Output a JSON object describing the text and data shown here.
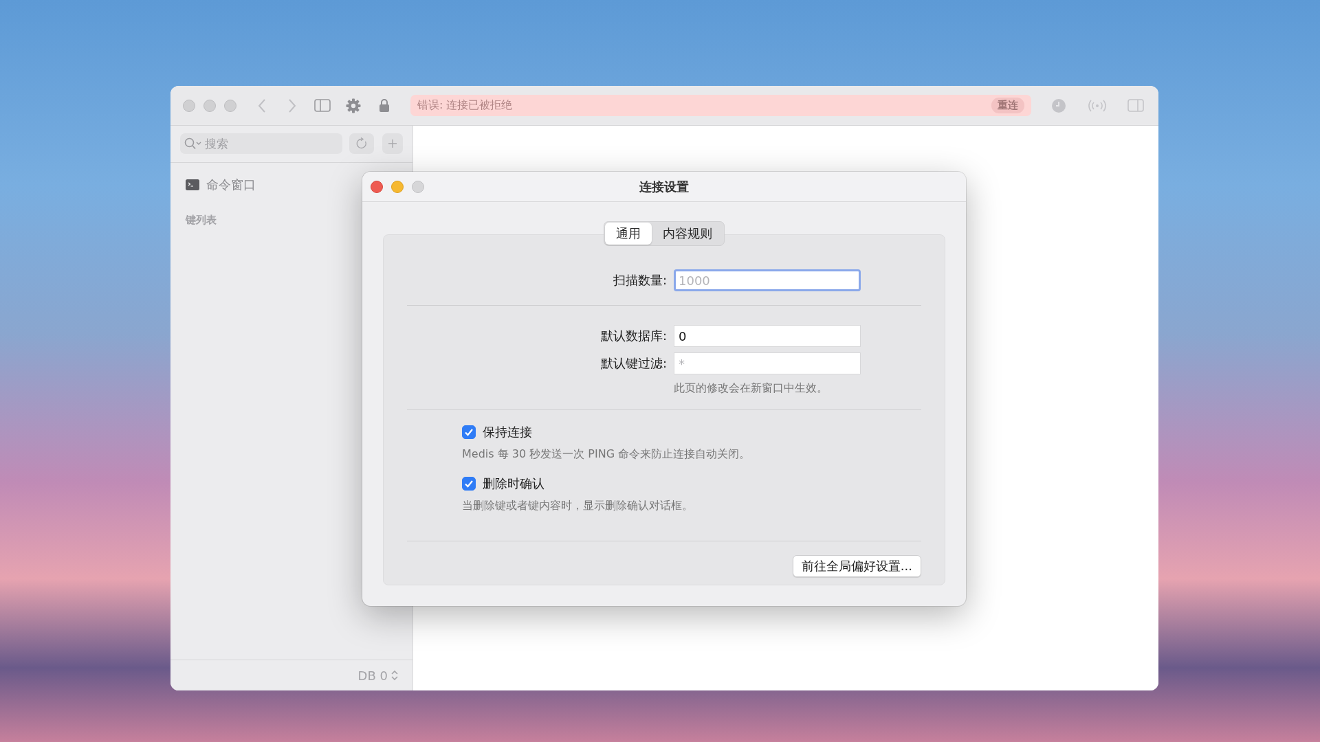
{
  "toolbar": {
    "error_text": "错误: 连接已被拒绝",
    "reconnect_button": "重连"
  },
  "sidebar": {
    "search": {
      "placeholder": "搜索"
    },
    "items": [
      {
        "label": "命令窗口",
        "kind": "terminal"
      }
    ],
    "section_title": "键列表",
    "db_selector": "DB 0"
  },
  "dialog": {
    "title": "连接设置",
    "tabs": [
      {
        "label": "通用",
        "selected": true
      },
      {
        "label": "内容规则",
        "selected": false
      }
    ],
    "scan_field": {
      "label": "扫描数量:",
      "placeholder": "1000",
      "focused": true
    },
    "fields": [
      {
        "label": "默认数据库:",
        "value": "0"
      },
      {
        "label": "默认键过滤:",
        "placeholder": "*"
      }
    ],
    "hint": "此页的修改会在新窗口中生效。",
    "checkboxes": [
      {
        "label": "保持连接",
        "description": "Medis 每 30 秒发送一次 PING 命令来防止连接自动关闭。",
        "checked": true
      },
      {
        "label": "删除时确认",
        "description": "当删除键或者键内容时，显示删除确认对话框。",
        "checked": true
      }
    ],
    "button": "前往全局偏好设置..."
  }
}
